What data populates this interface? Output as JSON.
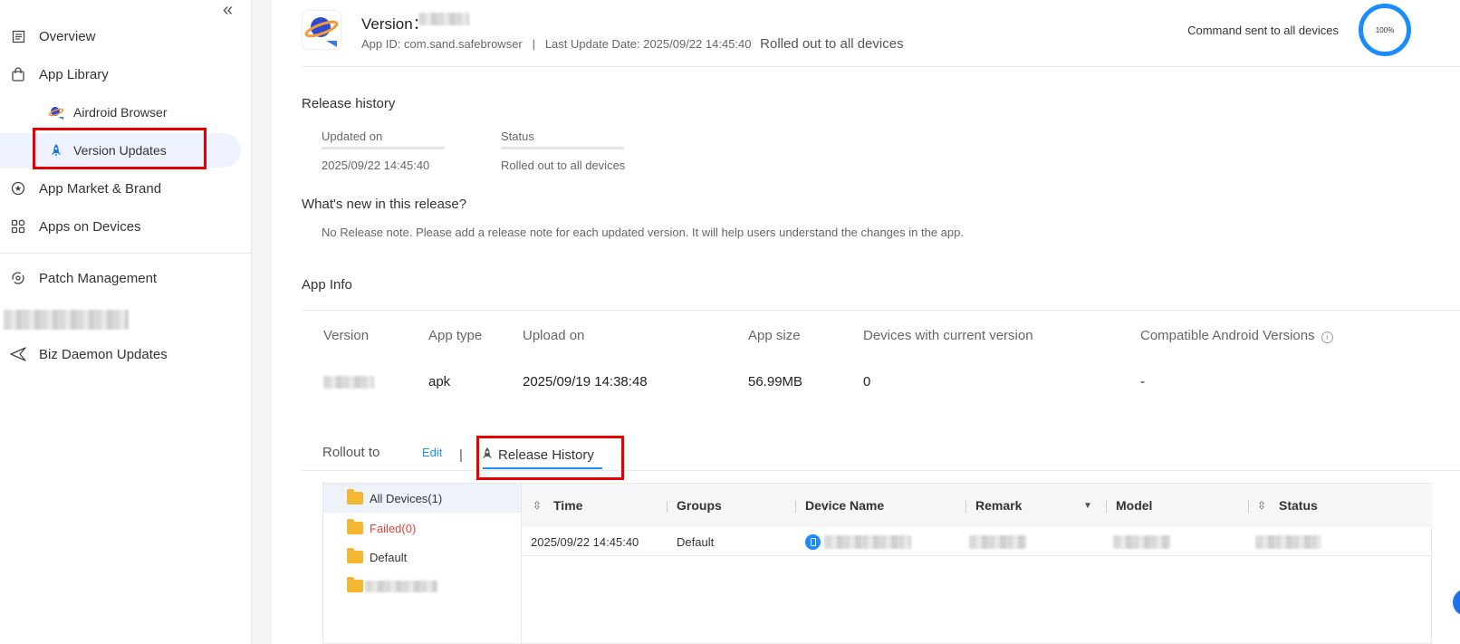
{
  "sidebar": {
    "collapse_icon": "double-chevron-left-icon",
    "items": [
      {
        "label": "Overview",
        "icon": "document-list-icon"
      },
      {
        "label": "App Library",
        "icon": "shopping-bag-icon"
      },
      {
        "label": "Airdroid Browser",
        "icon": "planet-app-icon"
      },
      {
        "label": "Version Updates",
        "icon": "rocket-icon"
      },
      {
        "label": "App Market & Brand",
        "icon": "star-circle-icon"
      },
      {
        "label": "Apps on Devices",
        "icon": "grid-apps-icon"
      },
      {
        "label": "Patch Management",
        "icon": "sync-gear-icon"
      },
      {
        "label": "Biz Daemon Updates",
        "icon": "send-icon"
      }
    ]
  },
  "header": {
    "version_label": "Version：",
    "app_id": "App ID: com.sand.safebrowser",
    "separator": "|",
    "last_update": "Last Update Date: 2025/09/22 14:45:40",
    "rollout_status": "Rolled out to all devices",
    "command_text": "Command sent to all devices",
    "progress_percent": 100,
    "progress_label": "100%"
  },
  "release_history": {
    "title": "Release history",
    "updated_on_label": "Updated on",
    "updated_on_value": "2025/09/22 14:45:40",
    "status_label": "Status",
    "status_value": "Rolled out to all devices"
  },
  "whats_new": {
    "title": "What's new in this release?",
    "note": "No Release note. Please add a release note for each updated version. It will help users understand the changes in the app."
  },
  "app_info": {
    "title": "App Info",
    "headers": [
      "Version",
      "App type",
      "Upload on",
      "App size",
      "Devices with current version",
      "Compatible Android Versions"
    ],
    "values": {
      "app_type": "apk",
      "upload_on": "2025/09/19 14:38:48",
      "app_size": "56.99MB",
      "devices": "0",
      "compatible": "-"
    }
  },
  "tabs": {
    "rollout_to": "Rollout to",
    "edit": "Edit",
    "divider": "|",
    "release_history": "Release History"
  },
  "tree": {
    "items": [
      {
        "label": "All Devices(1)"
      },
      {
        "label": "Failed(0)"
      },
      {
        "label": "Default"
      }
    ]
  },
  "table": {
    "columns": [
      "Time",
      "Groups",
      "Device Name",
      "Remark",
      "Model",
      "Status"
    ],
    "rows": [
      {
        "time": "2025/09/22 14:45:40",
        "group": "Default"
      }
    ]
  },
  "colors": {
    "accent": "#1a8cff",
    "failed": "#e8413c",
    "highlight": "#e60000"
  }
}
